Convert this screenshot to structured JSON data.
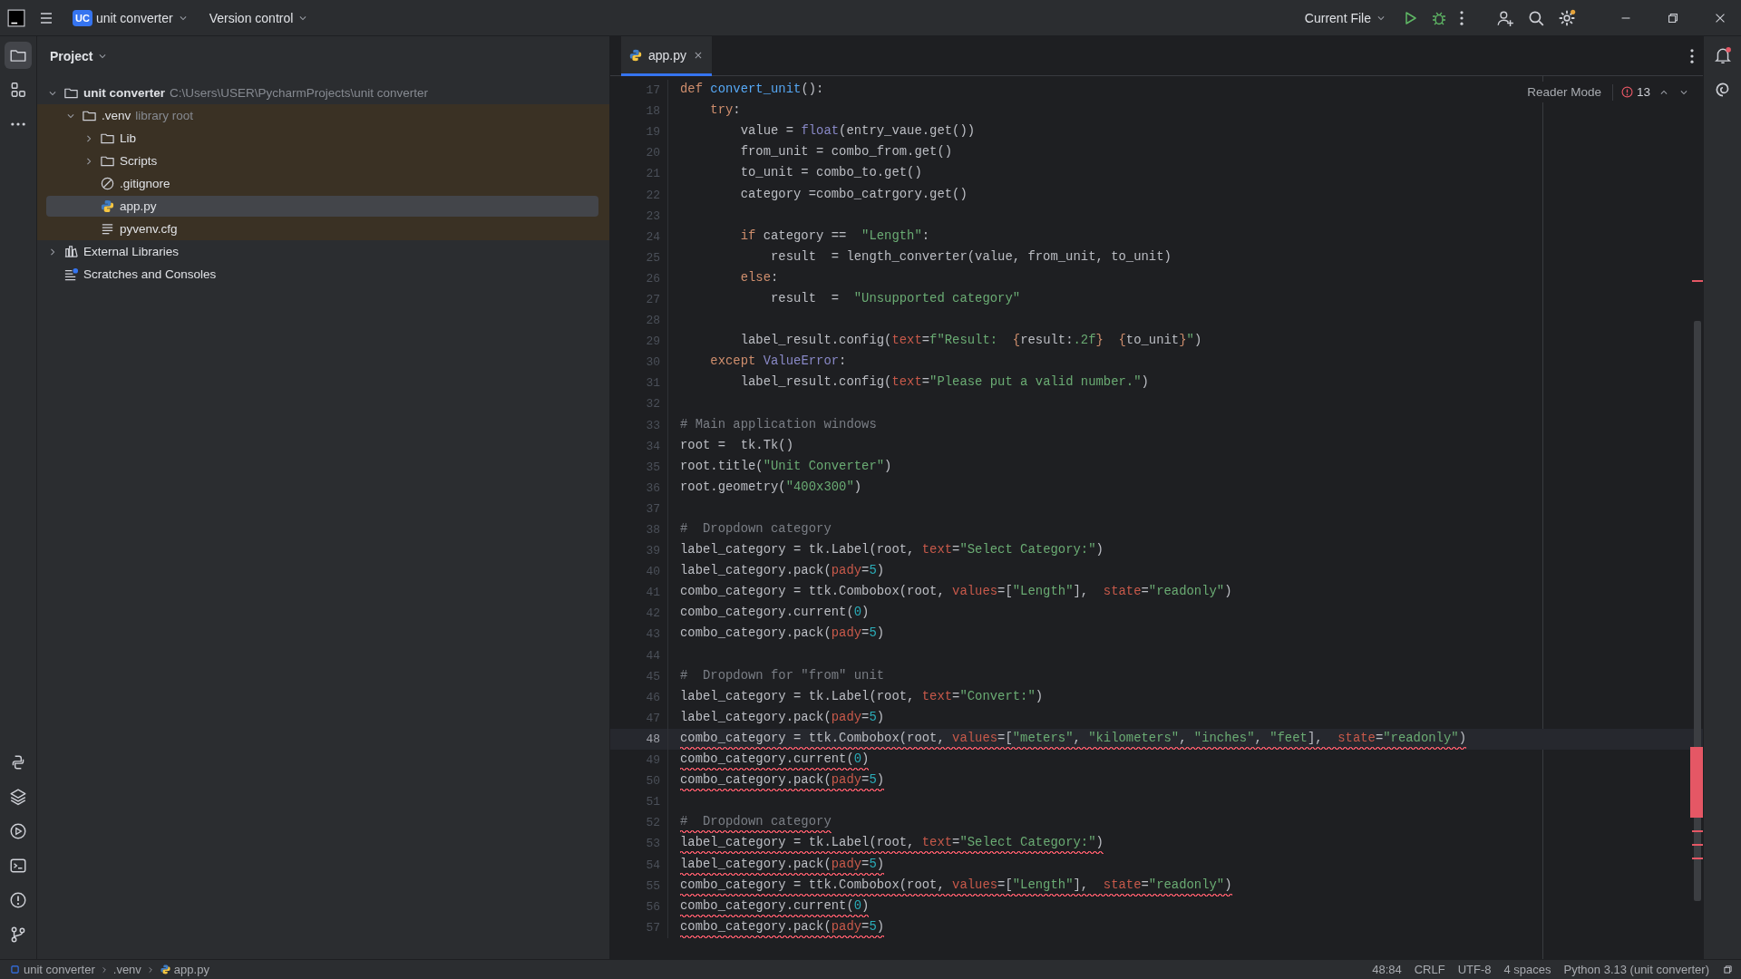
{
  "title_bar": {
    "project_badge": "UC",
    "project_name": "unit converter",
    "vcs": "Version control",
    "run_config": "Current File"
  },
  "left_toolbar": {
    "top": [
      {
        "kind": "project",
        "selected": true
      },
      {
        "kind": "structure",
        "selected": false
      },
      {
        "kind": "more",
        "selected": false
      }
    ],
    "bottom": [
      {
        "kind": "python_console",
        "selected": false
      },
      {
        "kind": "packages",
        "selected": false
      },
      {
        "kind": "services",
        "selected": false
      },
      {
        "kind": "terminal",
        "selected": false
      },
      {
        "kind": "problems",
        "selected": false
      },
      {
        "kind": "git",
        "selected": false
      }
    ]
  },
  "project_panel": {
    "title": "Project",
    "tree": [
      {
        "kind": "folder",
        "label": "unit converter",
        "hint": "C:\\Users\\USER\\PycharmProjects\\unit converter",
        "expanded": true,
        "selected": false,
        "library": false,
        "children": [
          {
            "kind": "folder",
            "label": ".venv",
            "hint": "library root",
            "expanded": true,
            "selected": false,
            "library": true,
            "children": [
              {
                "kind": "folder",
                "label": "Lib",
                "expanded": false,
                "selected": false,
                "library": true
              },
              {
                "kind": "folder",
                "label": "Scripts",
                "expanded": false,
                "selected": false,
                "library": true
              },
              {
                "kind": "ignore",
                "label": ".gitignore",
                "selected": false,
                "library": true
              },
              {
                "kind": "python",
                "label": "app.py",
                "selected": true,
                "library": true
              },
              {
                "kind": "text",
                "label": "pyvenv.cfg",
                "selected": false,
                "library": true
              }
            ]
          }
        ]
      },
      {
        "kind": "library",
        "label": "External Libraries",
        "expanded": false,
        "selected": false,
        "library": false
      },
      {
        "kind": "scratches",
        "label": "Scratches and Consoles",
        "selected": false,
        "library": false
      }
    ]
  },
  "tabs": [
    {
      "label": "app.py",
      "selected": true
    }
  ],
  "editor": {
    "reader_mode": "Reader Mode",
    "problem_count": "13",
    "lines": [
      {
        "number": "17",
        "current": false,
        "error": false,
        "tokens": [
          {
            "kind": "keyword",
            "text": "def "
          },
          {
            "kind": "function",
            "text": "convert_unit"
          },
          {
            "kind": "plain",
            "text": "():"
          }
        ]
      },
      {
        "number": "18",
        "current": false,
        "error": false,
        "tokens": [
          {
            "kind": "keyword",
            "text": "    try"
          },
          {
            "kind": "plain",
            "text": ":"
          }
        ]
      },
      {
        "number": "19",
        "current": false,
        "error": false,
        "tokens": [
          {
            "kind": "plain",
            "text": "        value = "
          },
          {
            "kind": "builtin",
            "text": "float"
          },
          {
            "kind": "plain",
            "text": "(entry_vaue.get())"
          }
        ]
      },
      {
        "number": "20",
        "current": false,
        "error": false,
        "tokens": [
          {
            "kind": "plain",
            "text": "        from_unit = combo_from.get()"
          }
        ]
      },
      {
        "number": "21",
        "current": false,
        "error": false,
        "tokens": [
          {
            "kind": "plain",
            "text": "        to_unit = combo_to.get()"
          }
        ]
      },
      {
        "number": "22",
        "current": false,
        "error": false,
        "tokens": [
          {
            "kind": "plain",
            "text": "        category =combo_catrgory.get()"
          }
        ]
      },
      {
        "number": "23",
        "current": false
      },
      {
        "number": "24",
        "current": false,
        "error": false,
        "tokens": [
          {
            "kind": "keyword",
            "text": "        if"
          },
          {
            "kind": "plain",
            "text": " category ==  "
          },
          {
            "kind": "string",
            "text": "\"Length\""
          },
          {
            "kind": "plain",
            "text": ":"
          }
        ]
      },
      {
        "number": "25",
        "current": false,
        "error": false,
        "tokens": [
          {
            "kind": "plain",
            "text": "            result  = length_converter(value, from_unit, to_unit)"
          }
        ]
      },
      {
        "number": "26",
        "current": false,
        "error": false,
        "tokens": [
          {
            "kind": "keyword",
            "text": "        else"
          },
          {
            "kind": "plain",
            "text": ":"
          }
        ]
      },
      {
        "number": "27",
        "current": false,
        "error": false,
        "tokens": [
          {
            "kind": "plain",
            "text": "            result  =  "
          },
          {
            "kind": "string",
            "text": "\"Unsupported category\""
          }
        ]
      },
      {
        "number": "28",
        "current": false
      },
      {
        "number": "29",
        "current": false,
        "error": false,
        "tokens": [
          {
            "kind": "plain",
            "text": "        label_result.config("
          },
          {
            "kind": "param",
            "text": "text"
          },
          {
            "kind": "plain",
            "text": "="
          },
          {
            "kind": "string",
            "text": "f\"Result:  "
          },
          {
            "kind": "brace",
            "text": "{"
          },
          {
            "kind": "plain",
            "text": "result:"
          },
          {
            "kind": "string",
            "text": ".2f"
          },
          {
            "kind": "brace",
            "text": "}  {"
          },
          {
            "kind": "plain",
            "text": "to_unit"
          },
          {
            "kind": "brace",
            "text": "}"
          },
          {
            "kind": "string",
            "text": "\""
          },
          {
            "kind": "plain",
            "text": ")"
          }
        ]
      },
      {
        "number": "30",
        "current": false,
        "error": false,
        "tokens": [
          {
            "kind": "keyword",
            "text": "    except "
          },
          {
            "kind": "builtin",
            "text": "ValueError"
          },
          {
            "kind": "plain",
            "text": ":"
          }
        ]
      },
      {
        "number": "31",
        "current": false,
        "error": false,
        "tokens": [
          {
            "kind": "plain",
            "text": "        label_result.config("
          },
          {
            "kind": "param",
            "text": "text"
          },
          {
            "kind": "plain",
            "text": "="
          },
          {
            "kind": "string",
            "text": "\"Please put a valid number.\""
          },
          {
            "kind": "plain",
            "text": ")"
          }
        ]
      },
      {
        "number": "32",
        "current": false
      },
      {
        "number": "33",
        "current": false,
        "error": false,
        "tokens": [
          {
            "kind": "comment",
            "text": "# Main application windows"
          }
        ]
      },
      {
        "number": "34",
        "current": false,
        "error": false,
        "tokens": [
          {
            "kind": "plain",
            "text": "root =  tk.Tk()"
          }
        ]
      },
      {
        "number": "35",
        "current": false,
        "error": false,
        "tokens": [
          {
            "kind": "plain",
            "text": "root.title("
          },
          {
            "kind": "string",
            "text": "\"Unit Converter\""
          },
          {
            "kind": "plain",
            "text": ")"
          }
        ]
      },
      {
        "number": "36",
        "current": false,
        "error": false,
        "tokens": [
          {
            "kind": "plain",
            "text": "root.geometry("
          },
          {
            "kind": "string",
            "text": "\"400x300\""
          },
          {
            "kind": "plain",
            "text": ")"
          }
        ]
      },
      {
        "number": "37",
        "current": false
      },
      {
        "number": "38",
        "current": false,
        "error": false,
        "tokens": [
          {
            "kind": "comment",
            "text": "#  Dropdown category"
          }
        ]
      },
      {
        "number": "39",
        "current": false,
        "error": false,
        "tokens": [
          {
            "kind": "plain",
            "text": "label_category = tk.Label(root, "
          },
          {
            "kind": "param",
            "text": "text"
          },
          {
            "kind": "plain",
            "text": "="
          },
          {
            "kind": "string",
            "text": "\"Select Category:\""
          },
          {
            "kind": "plain",
            "text": ")"
          }
        ]
      },
      {
        "number": "40",
        "current": false,
        "error": false,
        "tokens": [
          {
            "kind": "plain",
            "text": "label_category.pack("
          },
          {
            "kind": "param",
            "text": "pady"
          },
          {
            "kind": "plain",
            "text": "="
          },
          {
            "kind": "number",
            "text": "5"
          },
          {
            "kind": "plain",
            "text": ")"
          }
        ]
      },
      {
        "number": "41",
        "current": false,
        "error": false,
        "tokens": [
          {
            "kind": "plain",
            "text": "combo_category = ttk.Combobox(root, "
          },
          {
            "kind": "param",
            "text": "values"
          },
          {
            "kind": "plain",
            "text": "=["
          },
          {
            "kind": "string",
            "text": "\"Length\""
          },
          {
            "kind": "plain",
            "text": "],  "
          },
          {
            "kind": "param",
            "text": "state"
          },
          {
            "kind": "plain",
            "text": "="
          },
          {
            "kind": "string",
            "text": "\"readonly\""
          },
          {
            "kind": "plain",
            "text": ")"
          }
        ]
      },
      {
        "number": "42",
        "current": false,
        "error": false,
        "tokens": [
          {
            "kind": "plain",
            "text": "combo_category.current("
          },
          {
            "kind": "number",
            "text": "0"
          },
          {
            "kind": "plain",
            "text": ")"
          }
        ]
      },
      {
        "number": "43",
        "current": false,
        "error": false,
        "tokens": [
          {
            "kind": "plain",
            "text": "combo_category.pack("
          },
          {
            "kind": "param",
            "text": "pady"
          },
          {
            "kind": "plain",
            "text": "="
          },
          {
            "kind": "number",
            "text": "5"
          },
          {
            "kind": "plain",
            "text": ")"
          }
        ]
      },
      {
        "number": "44",
        "current": false
      },
      {
        "number": "45",
        "current": false,
        "error": false,
        "tokens": [
          {
            "kind": "comment",
            "text": "#  Dropdown for \"from\" unit"
          }
        ]
      },
      {
        "number": "46",
        "current": false,
        "error": false,
        "tokens": [
          {
            "kind": "plain",
            "text": "label_category = tk.Label(root, "
          },
          {
            "kind": "param",
            "text": "text"
          },
          {
            "kind": "plain",
            "text": "="
          },
          {
            "kind": "string",
            "text": "\"Convert:\""
          },
          {
            "kind": "plain",
            "text": ")"
          }
        ]
      },
      {
        "number": "47",
        "current": false,
        "error": false,
        "tokens": [
          {
            "kind": "plain",
            "text": "label_category.pack("
          },
          {
            "kind": "param",
            "text": "pady"
          },
          {
            "kind": "plain",
            "text": "="
          },
          {
            "kind": "number",
            "text": "5"
          },
          {
            "kind": "plain",
            "text": ")"
          }
        ]
      },
      {
        "number": "48",
        "current": true,
        "error": true,
        "tokens": [
          {
            "kind": "plain",
            "text": "combo_category = ttk.Combobox(root, "
          },
          {
            "kind": "param",
            "text": "values"
          },
          {
            "kind": "plain",
            "text": "=["
          },
          {
            "kind": "string",
            "text": "\"meters\""
          },
          {
            "kind": "plain",
            "text": ", "
          },
          {
            "kind": "string",
            "text": "\"kilometers\""
          },
          {
            "kind": "plain",
            "text": ", "
          },
          {
            "kind": "string",
            "text": "\"inches\""
          },
          {
            "kind": "plain",
            "text": ", "
          },
          {
            "kind": "string",
            "text": "\"feet"
          },
          {
            "kind": "plain",
            "text": "],  "
          },
          {
            "kind": "param",
            "text": "state"
          },
          {
            "kind": "plain",
            "text": "="
          },
          {
            "kind": "string",
            "text": "\"readonly\""
          },
          {
            "kind": "plain",
            "text": ")"
          }
        ]
      },
      {
        "number": "49",
        "current": false,
        "error": true,
        "tokens": [
          {
            "kind": "plain",
            "text": "combo_category.current("
          },
          {
            "kind": "number",
            "text": "0"
          },
          {
            "kind": "plain",
            "text": ")"
          }
        ]
      },
      {
        "number": "50",
        "current": false,
        "error": true,
        "tokens": [
          {
            "kind": "plain",
            "text": "combo_category.pack("
          },
          {
            "kind": "param",
            "text": "pady"
          },
          {
            "kind": "plain",
            "text": "="
          },
          {
            "kind": "number",
            "text": "5"
          },
          {
            "kind": "plain",
            "text": ")"
          }
        ]
      },
      {
        "number": "51",
        "current": false
      },
      {
        "number": "52",
        "current": false,
        "error": true,
        "tokens": [
          {
            "kind": "comment",
            "text": "#  Dropdown category"
          }
        ]
      },
      {
        "number": "53",
        "current": false,
        "error": true,
        "tokens": [
          {
            "kind": "plain",
            "text": "label_category = tk.Label(root, "
          },
          {
            "kind": "param",
            "text": "text"
          },
          {
            "kind": "plain",
            "text": "="
          },
          {
            "kind": "string",
            "text": "\"Select Category:\""
          },
          {
            "kind": "plain",
            "text": ")"
          }
        ]
      },
      {
        "number": "54",
        "current": false,
        "error": true,
        "tokens": [
          {
            "kind": "plain",
            "text": "label_category.pack("
          },
          {
            "kind": "param",
            "text": "pady"
          },
          {
            "kind": "plain",
            "text": "="
          },
          {
            "kind": "number",
            "text": "5"
          },
          {
            "kind": "plain",
            "text": ")"
          }
        ]
      },
      {
        "number": "55",
        "current": false,
        "error": true,
        "tokens": [
          {
            "kind": "plain",
            "text": "combo_category = ttk.Combobox(root, "
          },
          {
            "kind": "param",
            "text": "values"
          },
          {
            "kind": "plain",
            "text": "=["
          },
          {
            "kind": "string",
            "text": "\"Length\""
          },
          {
            "kind": "plain",
            "text": "],  "
          },
          {
            "kind": "param",
            "text": "state"
          },
          {
            "kind": "plain",
            "text": "="
          },
          {
            "kind": "string",
            "text": "\"readonly\""
          },
          {
            "kind": "plain",
            "text": ")"
          }
        ]
      },
      {
        "number": "56",
        "current": false,
        "error": true,
        "tokens": [
          {
            "kind": "plain",
            "text": "combo_category.current("
          },
          {
            "kind": "number",
            "text": "0"
          },
          {
            "kind": "plain",
            "text": ")"
          }
        ]
      },
      {
        "number": "57",
        "current": false,
        "error": true,
        "tokens": [
          {
            "kind": "plain",
            "text": "combo_category.pack("
          },
          {
            "kind": "param",
            "text": "pady"
          },
          {
            "kind": "plain",
            "text": "="
          },
          {
            "kind": "number",
            "text": "5"
          },
          {
            "kind": "plain",
            "text": ")"
          }
        ]
      }
    ]
  },
  "status_bar": {
    "breadcrumbs": [
      {
        "kind": "module",
        "label": "unit converter"
      },
      {
        "kind": "folder",
        "label": ".venv"
      },
      {
        "kind": "python",
        "label": "app.py"
      }
    ],
    "items": [
      "48:84",
      "CRLF",
      "UTF-8",
      "4 spaces",
      "Python 3.13 (unit converter)"
    ]
  }
}
